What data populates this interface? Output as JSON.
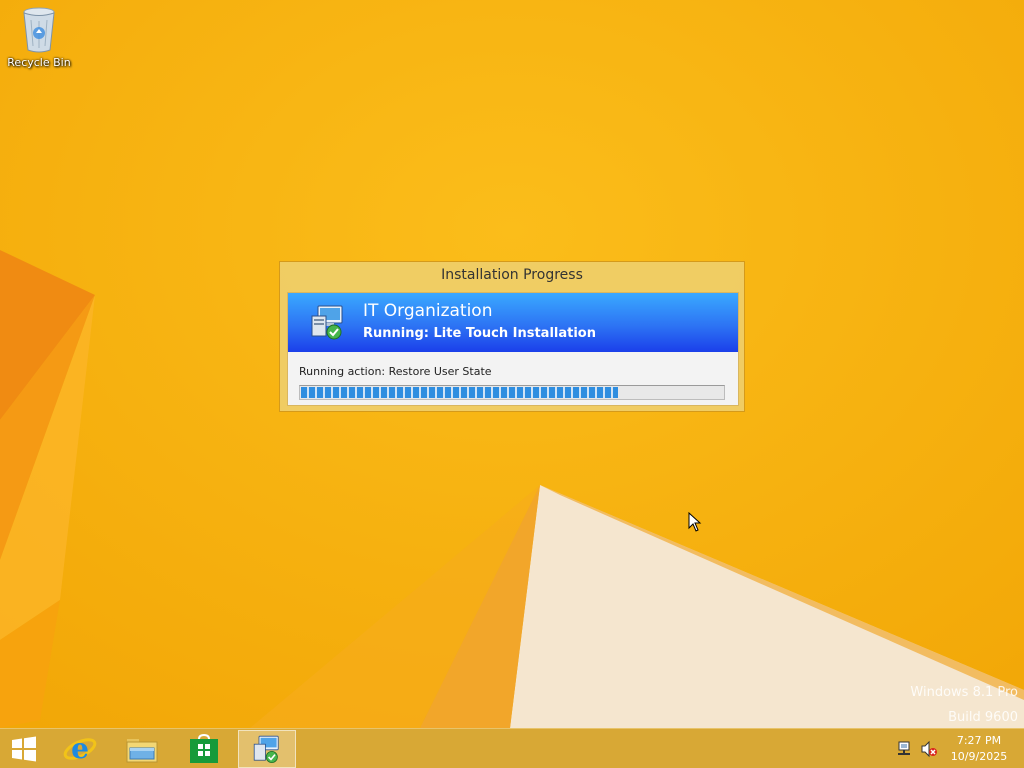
{
  "desktop": {
    "icons": [
      {
        "label": "Recycle Bin",
        "icon": "recycle-bin-icon"
      }
    ],
    "watermark": {
      "line1": "Windows 8.1 Pro",
      "line2": "Build 9600"
    }
  },
  "dialog": {
    "title": "Installation Progress",
    "banner": {
      "organization": "IT Organization",
      "status": "Running: Lite Touch Installation",
      "icon": "deployment-icon"
    },
    "action_text": "Running action: Restore User State",
    "progress": 0.75
  },
  "taskbar": {
    "start_icon": "windows-start-icon",
    "pinned": [
      {
        "name": "internet-explorer",
        "icon": "internet-explorer-icon",
        "active": false
      },
      {
        "name": "file-explorer",
        "icon": "folder-icon",
        "active": false
      },
      {
        "name": "windows-store",
        "icon": "store-icon",
        "active": false
      },
      {
        "name": "deployment-wizard",
        "icon": "deployment-icon",
        "active": true
      }
    ],
    "tray": {
      "network_icon": "network-icon",
      "volume_icon": "volume-muted-icon",
      "time": "7:27 PM",
      "date": "10/9/2025"
    }
  },
  "colors": {
    "wallpaper": "#f6b20c",
    "banner_top": "#3aa9ff",
    "banner_bottom": "#1b3fea",
    "progress": "#2f8ee0"
  }
}
